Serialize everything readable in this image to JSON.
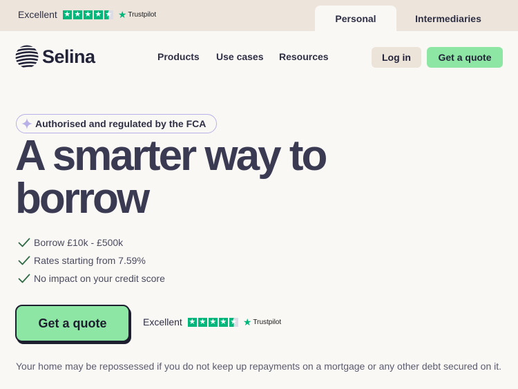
{
  "trustpilot_top": {
    "label": "Excellent",
    "brand": "Trustpilot",
    "rating_stars": 4.5
  },
  "tabs": [
    {
      "label": "Personal",
      "active": true
    },
    {
      "label": "Intermediaries",
      "active": false
    }
  ],
  "brand": {
    "name": "Selina"
  },
  "nav": {
    "items": [
      "Products",
      "Use cases",
      "Resources"
    ]
  },
  "header_actions": {
    "login_label": "Log in",
    "quote_label": "Get a quote"
  },
  "hero": {
    "badge": "Authorised and regulated by the FCA",
    "headline_line1": "A smarter way to",
    "headline_line2": "borrow",
    "features": [
      "Borrow £10k - £500k",
      "Rates starting from 7.59%",
      "No impact on your credit score"
    ],
    "cta_label": "Get a quote"
  },
  "trustpilot_mid": {
    "label": "Excellent",
    "brand": "Trustpilot",
    "rating_stars": 4.5
  },
  "disclaimer": "Your home may be repossessed if you do not keep up repayments on a mortgage or any other debt secured on it.",
  "colors": {
    "accent_green": "#8ee6a4",
    "trustpilot_green": "#00b67a",
    "text_dark": "#2e2f44",
    "topbar_bg": "#ede5dc",
    "page_bg": "#faf8f5",
    "badge_border": "#b7b1e8"
  },
  "icons": {
    "badge": "sparkle-icon",
    "feature": "check-icon",
    "trustpilot": "trustpilot-star-icon"
  }
}
